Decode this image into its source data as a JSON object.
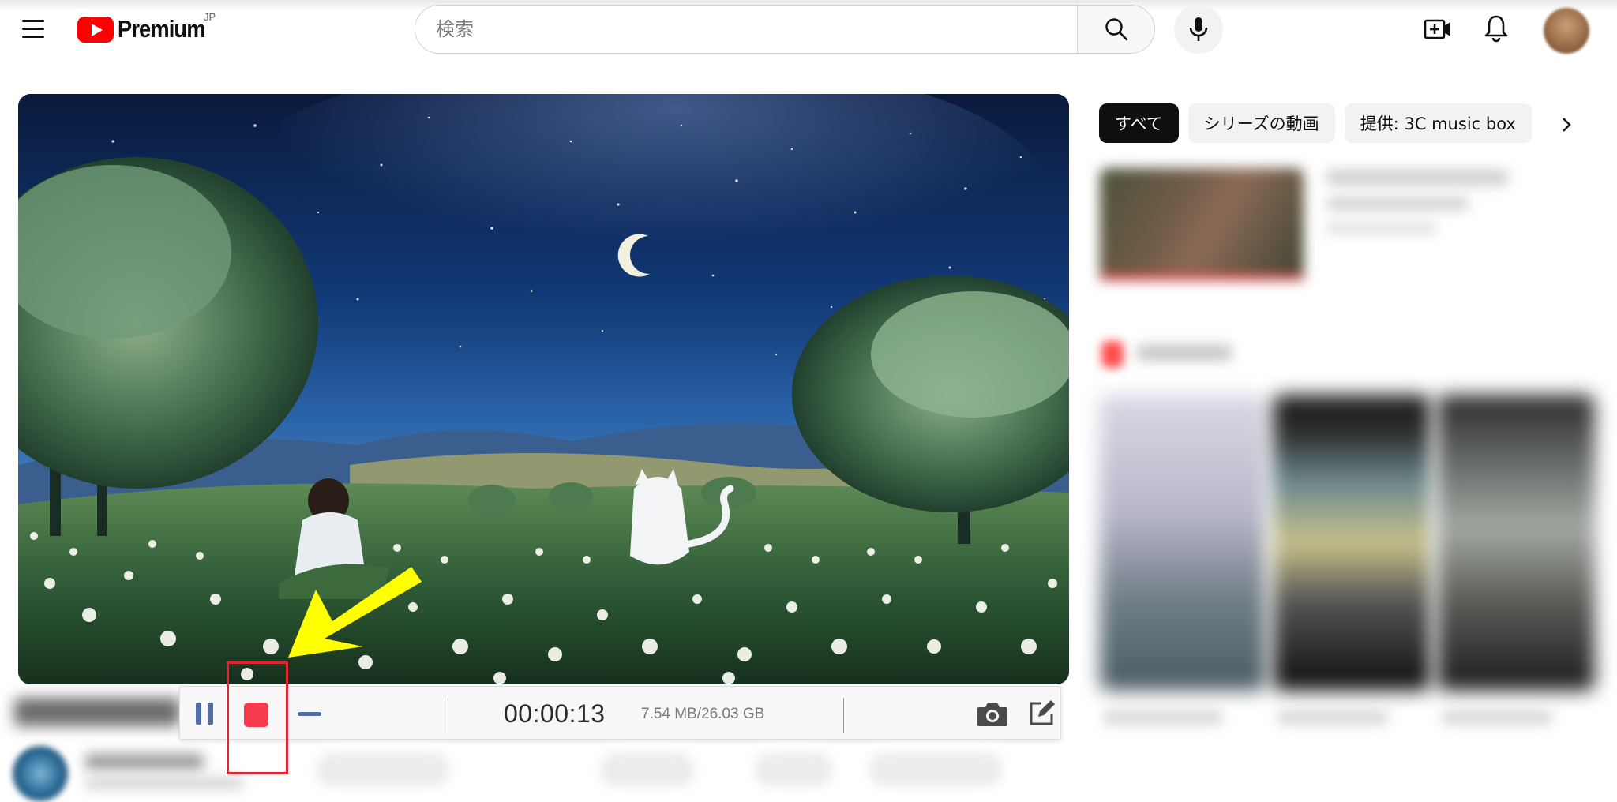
{
  "header": {
    "logo_text": "Premium",
    "region": "JP",
    "search_placeholder": "検索"
  },
  "chips": [
    {
      "label": "すべて",
      "active": true
    },
    {
      "label": "シリーズの動画",
      "active": false
    },
    {
      "label": "提供: 3C music box",
      "active": false
    }
  ],
  "recorder": {
    "elapsed": "00:00:13",
    "file_size": "7.54 MB/26.03 GB"
  },
  "icons": {
    "menu": "menu-icon",
    "search": "search-icon",
    "mic": "mic-icon",
    "create": "create-video-icon",
    "notifications": "bell-icon",
    "pause": "pause-icon",
    "stop": "stop-icon",
    "minimize": "minimize-icon",
    "screenshot": "camera-icon",
    "edit": "edit-icon",
    "next": "chevron-right-icon"
  },
  "colors": {
    "brand_red": "#ff0000",
    "stop_red": "#f53b4d",
    "annotation_red": "#e3232f",
    "arrow_yellow": "#ffff00",
    "control_blue": "#4f6fa6"
  }
}
